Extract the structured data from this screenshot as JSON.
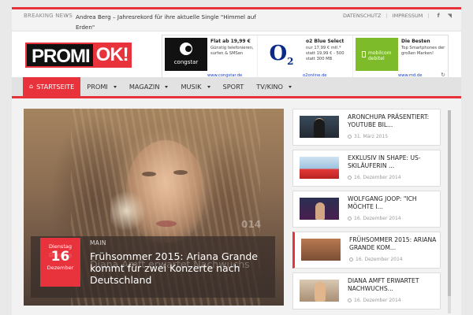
{
  "breaking": {
    "label": "BREAKING NEWS",
    "text": "Andrea Berg – Jahresrekord für ihre aktuelle Single \"Himmel auf Erden\""
  },
  "toplinks": {
    "datenschutz": "DATENSCHUTZ",
    "impressum": "IMPRESSUM",
    "separator": "|"
  },
  "logo": {
    "part1": "PROMI",
    "part2": "OK!"
  },
  "ads": [
    {
      "brand": "congstar",
      "title": "Flat ab 19,99 €",
      "desc": "Günstig telefonieren, surfen & SMSen",
      "link": "www.congstar.de"
    },
    {
      "brand": "O2",
      "title": "o2 Blue Select",
      "desc": "nur 17,99 € mtl.* statt 19,99 € - 500 statt 300 MB",
      "link": "o2online.de"
    },
    {
      "brand": "mobilcom debitel",
      "title": "Die Besten",
      "desc": "Top Smartphones der großen Marken!",
      "link": "www.md.de"
    }
  ],
  "nav": {
    "items": [
      {
        "label": "STARTSEITE",
        "active": true
      },
      {
        "label": "PROMI",
        "dropdown": true
      },
      {
        "label": "MAGAZIN",
        "dropdown": true
      },
      {
        "label": "MUSIK",
        "dropdown": true
      },
      {
        "label": "SPORT"
      },
      {
        "label": "TV/KINO",
        "dropdown": true
      }
    ]
  },
  "slider": {
    "category": "MAIN",
    "date": {
      "weekday": "Dienstag",
      "day": "16",
      "month": "Dezember"
    },
    "title": "Frühsommer 2015: Ariana Grande kommt für zwei Konzerte nach Deutschland",
    "ghost_title": "Diana Amft erwartet Nachwuchs",
    "ghost_weekday": "Dienstag",
    "overlay_num": "014"
  },
  "sidebar": [
    {
      "title": "ARONCHUPA PRÄSENTIERT: YOUTUBE BIL...",
      "date": "31. März 2015"
    },
    {
      "title": "EXKLUSIV IN SHAPE: US-SKILÄUFERIN ...",
      "date": "16. Dezember 2014"
    },
    {
      "title": "WOLFGANG JOOP: \"ICH MÖCHTE I...",
      "date": "16. Dezember 2014"
    },
    {
      "title": "FRÜHSOMMER 2015: ARIANA GRANDE KOM...",
      "date": "16. Dezember 2014",
      "active": true
    },
    {
      "title": "DIANA AMFT ERWARTET NACHWUCHS...",
      "date": "16. Dezember 2014"
    }
  ],
  "colors": {
    "accent": "#e8323c",
    "nav_bg": "#e2e2e2"
  }
}
